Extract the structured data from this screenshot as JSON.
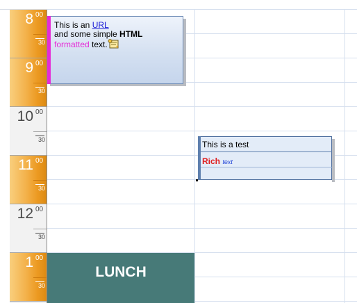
{
  "colors": {
    "gutter_highlight": "#ec9a22",
    "event1_category_bar": "#e52bd6",
    "event2_bar": "#5e7fae",
    "lunch_block": "#477a78",
    "link": "#1b1bd6",
    "rich_red": "#e01e1e",
    "text_blue": "#1b3fd6"
  },
  "time_gutter": {
    "slots": [
      {
        "hour": "8",
        "minutes": "00",
        "half": "30",
        "highlighted": true
      },
      {
        "hour": "9",
        "minutes": "00",
        "half": "30",
        "highlighted": true
      },
      {
        "hour": "10",
        "minutes": "00",
        "half": "30",
        "highlighted": false
      },
      {
        "hour": "11",
        "minutes": "00",
        "half": "30",
        "highlighted": true
      },
      {
        "hour": "12",
        "minutes": "00",
        "half": "30",
        "highlighted": false
      },
      {
        "hour": "1",
        "minutes": "00",
        "half": "30",
        "highlighted": true
      }
    ]
  },
  "event1": {
    "text_before_link": "This is an ",
    "link_text": "URL",
    "line2_prefix": "and some simple ",
    "line2_bold": "HTML",
    "line3_colored": "formatted",
    "line3_suffix": " text.",
    "icon": "note-icon"
  },
  "event2": {
    "subject": "This is a test",
    "rich_word": "Rich",
    "text_word": "text"
  },
  "lunch": {
    "label": "LUNCH"
  }
}
